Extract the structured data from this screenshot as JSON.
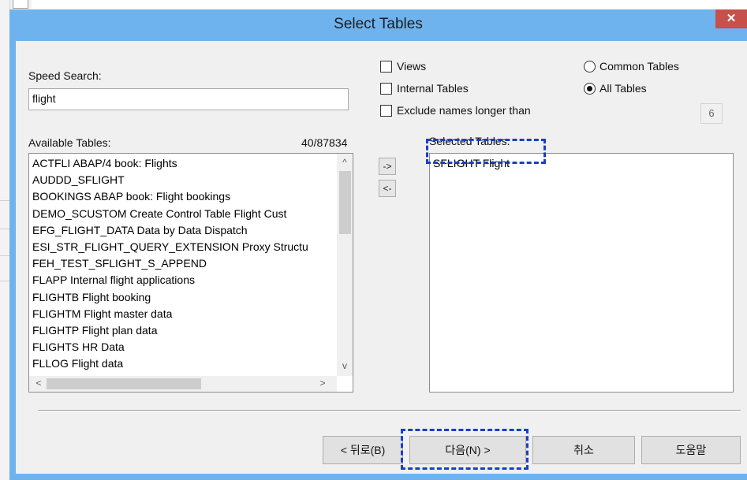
{
  "dialog": {
    "title": "Select Tables",
    "close_glyph": "✕"
  },
  "speed_search": {
    "label": "Speed Search:",
    "value": "flight"
  },
  "available": {
    "label": "Available Tables:",
    "count": "40/87834",
    "items": [
      "ACTFLI ABAP/4 book: Flights",
      "AUDDD_SFLIGHT",
      "BOOKINGS ABAP book: Flight bookings",
      "DEMO_SCUSTOM Create Control Table Flight Cust",
      "EFG_FLIGHT_DATA Data by Data Dispatch",
      "ESI_STR_FLIGHT_QUERY_EXTENSION Proxy Structu",
      "FEH_TEST_SFLIGHT_S_APPEND",
      "FLAPP Internal flight applications",
      "FLIGHTB Flight booking",
      "FLIGHTM Flight master data",
      "FLIGHTP Flight plan data",
      "FLIGHTS HR Data",
      "FLLOG Flight data"
    ]
  },
  "move_buttons": {
    "add": "->",
    "remove": "<-"
  },
  "options": {
    "views": "Views",
    "internal_tables": "Internal Tables",
    "exclude_names": "Exclude names longer than",
    "exclude_length": "6"
  },
  "scope": {
    "common_tables": "Common Tables",
    "all_tables": "All Tables"
  },
  "selected": {
    "label": "Selected Tables:",
    "items": [
      "SFLIGHT Flight"
    ]
  },
  "buttons": {
    "back": "< 뒤로(B)",
    "next": "다음(N) >",
    "cancel": "취소",
    "help": "도움말"
  },
  "scroll_glyphs": {
    "up": "^",
    "down": "v",
    "left": "<",
    "right": ">"
  },
  "colors": {
    "title_bar": "#6fb3ee",
    "close_button": "#c7504a",
    "highlight": "#1a3ec8"
  }
}
